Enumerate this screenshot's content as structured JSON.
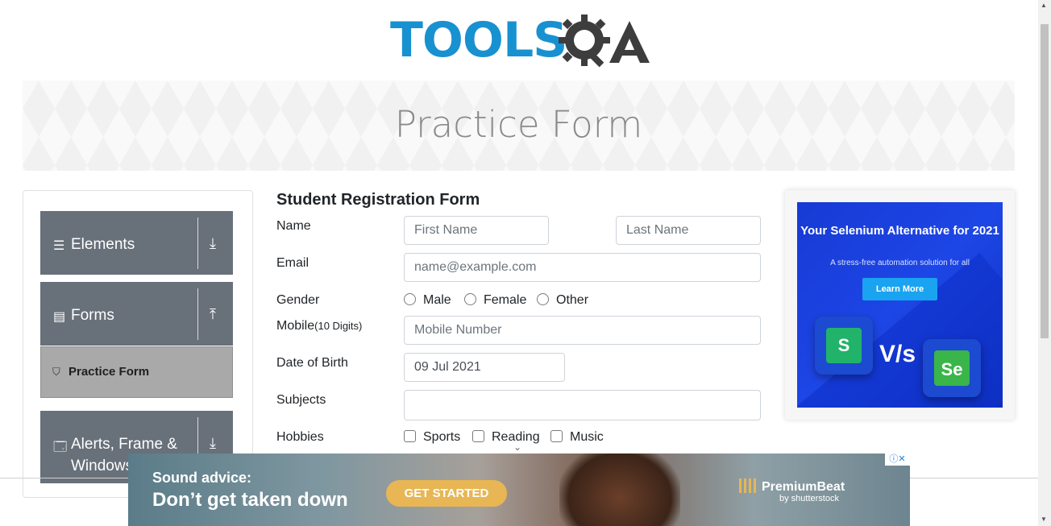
{
  "logo": {
    "part1": "TOOLS",
    "part2": "QA"
  },
  "banner": {
    "title": "Practice Form"
  },
  "sidebar": {
    "groups": [
      {
        "label": "Elements",
        "icon": "hamburger-icon",
        "arrow": "download-arrow-icon"
      },
      {
        "label": "Forms",
        "icon": "document-icon",
        "arrow": "upload-arrow-icon"
      },
      {
        "label": "Alerts, Frame & Windows",
        "icon": "window-icon",
        "arrow": "download-arrow-icon"
      }
    ],
    "active_item": {
      "label": "Practice Form",
      "icon": "html5-icon"
    }
  },
  "form": {
    "title": "Student Registration Form",
    "name_label": "Name",
    "first_name_placeholder": "First Name",
    "last_name_placeholder": "Last Name",
    "email_label": "Email",
    "email_placeholder": "name@example.com",
    "gender_label": "Gender",
    "gender_options": [
      "Male",
      "Female",
      "Other"
    ],
    "mobile_label": "Mobile",
    "mobile_hint": "(10 Digits)",
    "mobile_placeholder": "Mobile Number",
    "dob_label": "Date of Birth",
    "dob_value": "09 Jul 2021",
    "subjects_label": "Subjects",
    "subjects_value": "",
    "hobbies_label": "Hobbies",
    "hobby_options": [
      "Sports",
      "Reading",
      "Music"
    ]
  },
  "side_ad": {
    "title": "Your Selenium Alternative for 2021",
    "subtitle": "A stress-free automation solution for all",
    "button": "Learn More",
    "vs": "V/s",
    "tile1": "S",
    "tile2": "Se"
  },
  "bottom_ad": {
    "line1": "Sound advice:",
    "line2": "Don’t get taken down",
    "button": "GET STARTED",
    "brand": "PremiumBeat",
    "brand_sub": "by shutterstock",
    "adchoices": "ⓘ✕"
  },
  "colors": {
    "brand_blue": "#1891d1",
    "sidebar_group": "#68707a",
    "sidebar_active": "#a9a9a9",
    "ad_blue": "#1d46e6",
    "ad_button": "#1aa3f0",
    "cta_gold": "#e8b654"
  }
}
